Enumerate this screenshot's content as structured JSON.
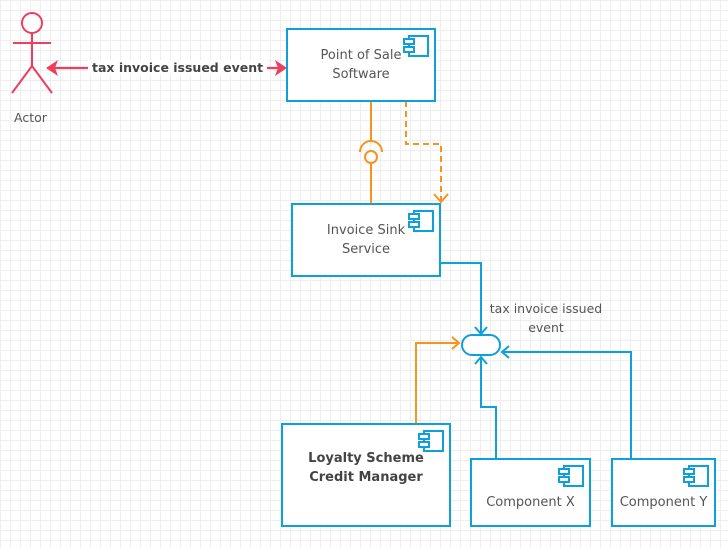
{
  "diagram": {
    "type": "uml-component",
    "colors": {
      "component_border": "#0ea0da",
      "actor": "#ee3e5d",
      "interface_orange": "#f7931e",
      "text": "#555555"
    },
    "actor": {
      "label": "Actor",
      "icon": "stick-figure-icon"
    },
    "actor_link": {
      "label": "tax invoice issued event"
    },
    "components": [
      {
        "id": "pos",
        "label_lines": [
          "Point of Sale",
          "Software"
        ],
        "bold": false
      },
      {
        "id": "sink",
        "label_lines": [
          "Invoice Sink",
          "Service"
        ],
        "bold": false
      },
      {
        "id": "loyalty",
        "label_lines": [
          "Loyalty Scheme",
          "Credit Manager"
        ],
        "bold": true
      },
      {
        "id": "compx",
        "label_lines": [
          "Component X"
        ],
        "bold": false
      },
      {
        "id": "compy",
        "label_lines": [
          "Component Y"
        ],
        "bold": false
      }
    ],
    "event_node": {
      "label_lines": [
        "tax invoice issued",
        "event"
      ]
    },
    "connections": [
      {
        "from": "actor",
        "to": "pos",
        "style": "bidirectional-arrow",
        "color": "actor"
      },
      {
        "from": "pos",
        "to": "sink",
        "style": "ball-and-socket",
        "color": "orange"
      },
      {
        "from": "pos",
        "to": "sink",
        "style": "dashed-dependency",
        "color": "orange"
      },
      {
        "from": "sink",
        "to": "event",
        "style": "arrow",
        "color": "blue"
      },
      {
        "from": "loyalty",
        "to": "event",
        "style": "arrow",
        "color": "orange"
      },
      {
        "from": "compx",
        "to": "event",
        "style": "arrow",
        "color": "blue"
      },
      {
        "from": "compy",
        "to": "event",
        "style": "arrow",
        "color": "blue"
      }
    ]
  }
}
